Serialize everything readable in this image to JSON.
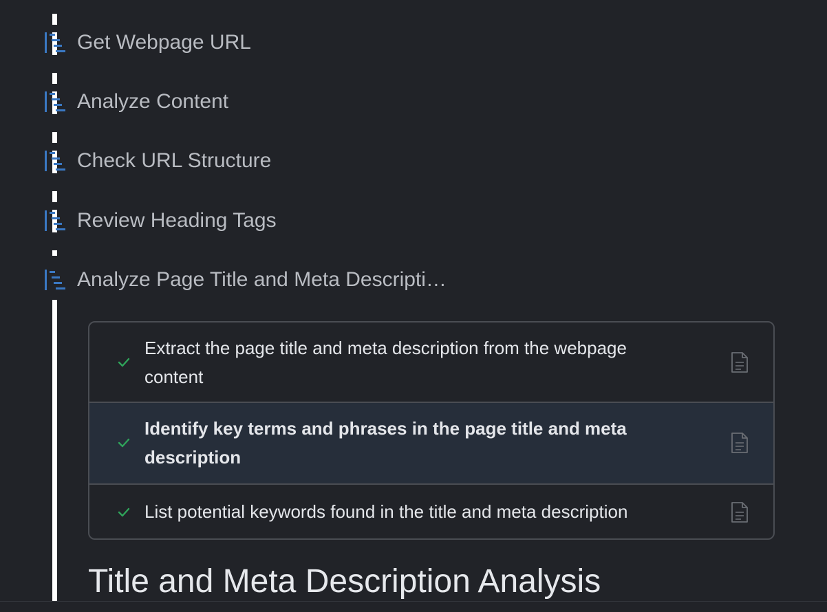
{
  "colors": {
    "background": "#212328",
    "step_icon": "#3a78c3",
    "check": "#2fa35a",
    "highlight_row": "#262e3a"
  },
  "steps": [
    {
      "label": "Get Webpage URL",
      "icon": "workflow-step-icon"
    },
    {
      "label": "Analyze Content",
      "icon": "workflow-step-icon"
    },
    {
      "label": "Check URL Structure",
      "icon": "workflow-step-icon"
    },
    {
      "label": "Review Heading Tags",
      "icon": "workflow-step-icon"
    },
    {
      "label": "Analyze Page Title and Meta Descripti…",
      "icon": "workflow-step-icon"
    }
  ],
  "tasks": [
    {
      "text": "Extract the page title and meta description from the webpage content",
      "status": "complete",
      "icon": "document-icon"
    },
    {
      "text": "Identify key terms and phrases in the page title and meta description",
      "status": "complete",
      "icon": "document-icon",
      "selected": true
    },
    {
      "text": "List potential keywords found in the title and meta description",
      "status": "complete",
      "icon": "document-icon"
    }
  ],
  "section": {
    "heading": "Title and Meta Description Analysis"
  }
}
